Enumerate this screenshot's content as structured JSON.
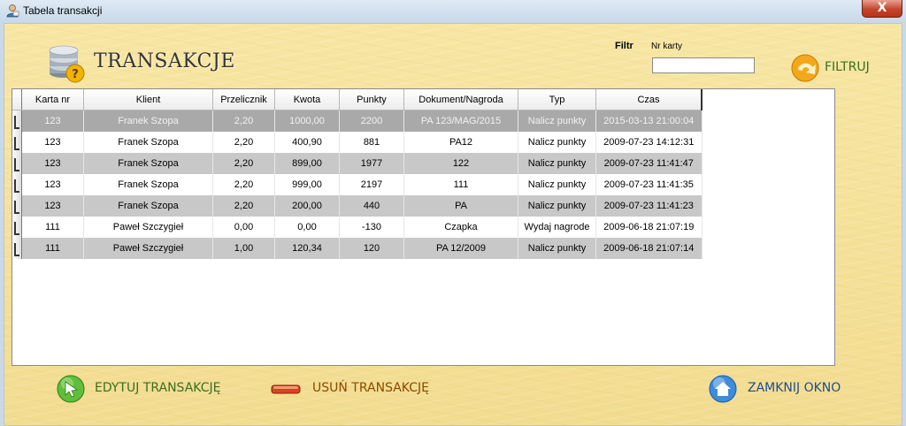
{
  "window": {
    "title": "Tabela transakcji",
    "close_symbol": "X"
  },
  "header": {
    "title": "TRANSAKCJE",
    "logo_icon": "coins-question-icon"
  },
  "filter": {
    "label": "Filtr",
    "card_label": "Nr karty",
    "card_value": "",
    "button_label": "FILTRUJ"
  },
  "table": {
    "columns": [
      "Karta nr",
      "Klient",
      "Przelicznik",
      "Kwota",
      "Punkty",
      "Dokument/Nagroda",
      "Typ",
      "Czas"
    ],
    "rows": [
      [
        "123",
        "Franek Szopa",
        "2,20",
        "1000,00",
        "2200",
        "PA 123/MAG/2015",
        "Nalicz punkty",
        "2015-03-13 21:00:04"
      ],
      [
        "123",
        "Franek Szopa",
        "2,20",
        "400,90",
        "881",
        "PA12",
        "Nalicz punkty",
        "2009-07-23 14:12:31"
      ],
      [
        "123",
        "Franek Szopa",
        "2,20",
        "899,00",
        "1977",
        "122",
        "Nalicz punkty",
        "2009-07-23 11:41:47"
      ],
      [
        "123",
        "Franek Szopa",
        "2,20",
        "999,00",
        "2197",
        "111",
        "Nalicz punkty",
        "2009-07-23 11:41:35"
      ],
      [
        "123",
        "Franek Szopa",
        "2,20",
        "200,00",
        "440",
        "PA",
        "Nalicz punkty",
        "2009-07-23 11:41:23"
      ],
      [
        "111",
        "Paweł Szczygieł",
        "0,00",
        "0,00",
        "-130",
        "Czapka",
        "Wydaj nagrode",
        "2009-06-18 21:07:19"
      ],
      [
        "111",
        "Paweł Szczygieł",
        "1,00",
        "120,34",
        "120",
        "PA 12/2009",
        "Nalicz punkty",
        "2009-06-18 21:07:14"
      ]
    ],
    "selected_row": 0
  },
  "actions": {
    "edit_label": "EDYTUJ TRANSAKCJĘ",
    "delete_label": "USUŃ TRANSAKCJĘ",
    "close_label": "ZAMKNIJ OKNO"
  },
  "colors": {
    "background": "#f6e39b",
    "green_text": "#3a6f1e",
    "red_text": "#8a4a00",
    "blue_text": "#1f4e8c",
    "selected_row": "#a9a9a9",
    "alt_row": "#c8c8c8"
  }
}
